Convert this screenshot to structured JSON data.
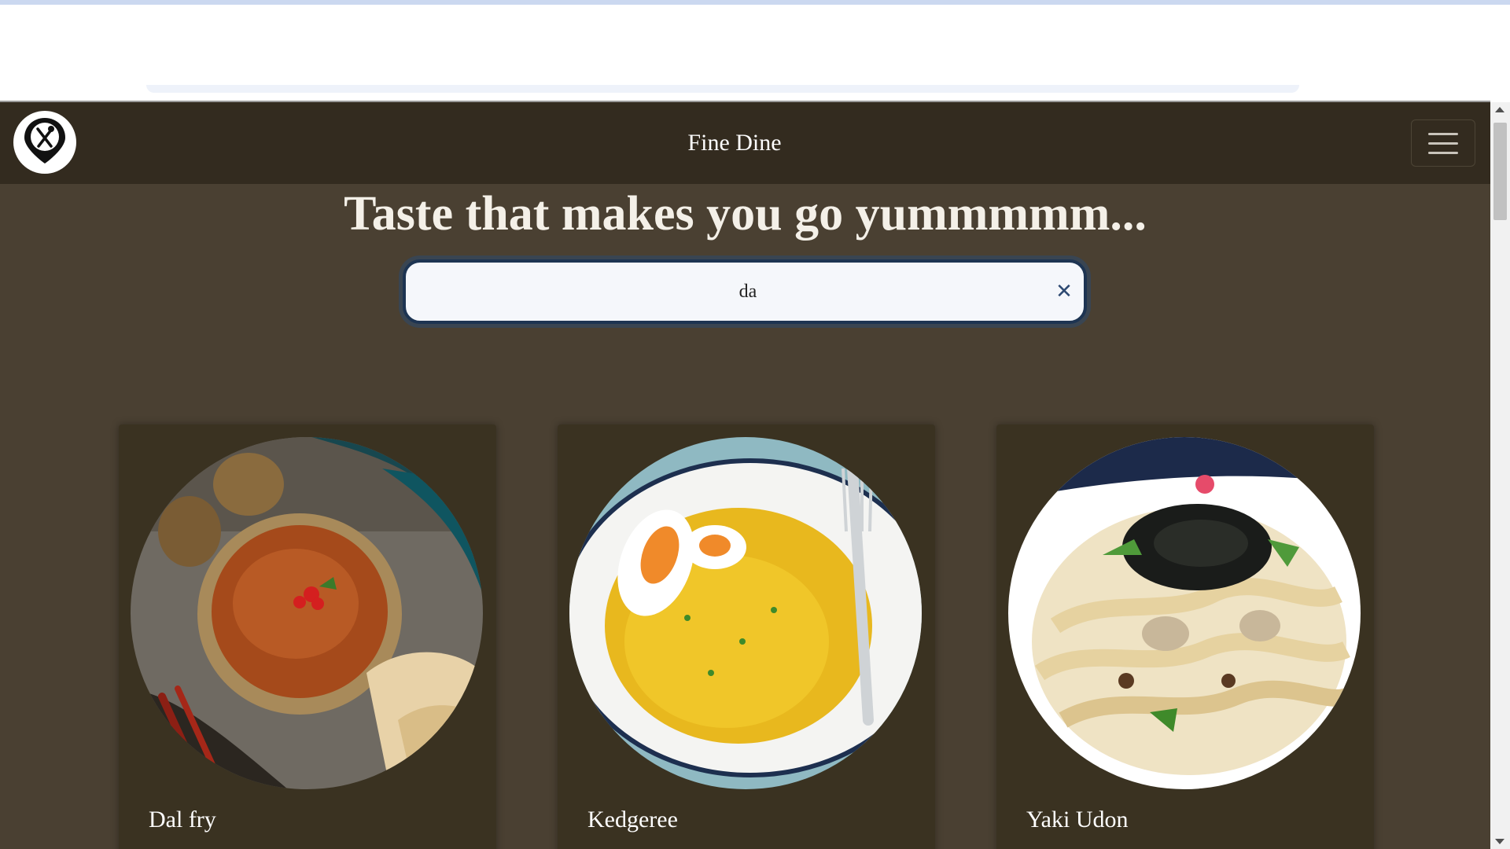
{
  "navbar": {
    "brand": "Fine Dine",
    "logo_icon": "fork-knife-pin-icon",
    "menu_icon": "hamburger-icon"
  },
  "hero": {
    "headline": "Taste that makes you go yummmmm..."
  },
  "search": {
    "value": "da",
    "clear_icon": "close-icon"
  },
  "results": [
    {
      "title": "Dal fry",
      "image": "dal-fry-bowl"
    },
    {
      "title": "Kedgeree",
      "image": "kedgeree-plate"
    },
    {
      "title": "Yaki Udon",
      "image": "yaki-udon-plate"
    }
  ],
  "colors": {
    "page_background": "#4a4032",
    "navbar": "#332b1f",
    "card": "#3a3221",
    "search_border": "#1d3452"
  }
}
